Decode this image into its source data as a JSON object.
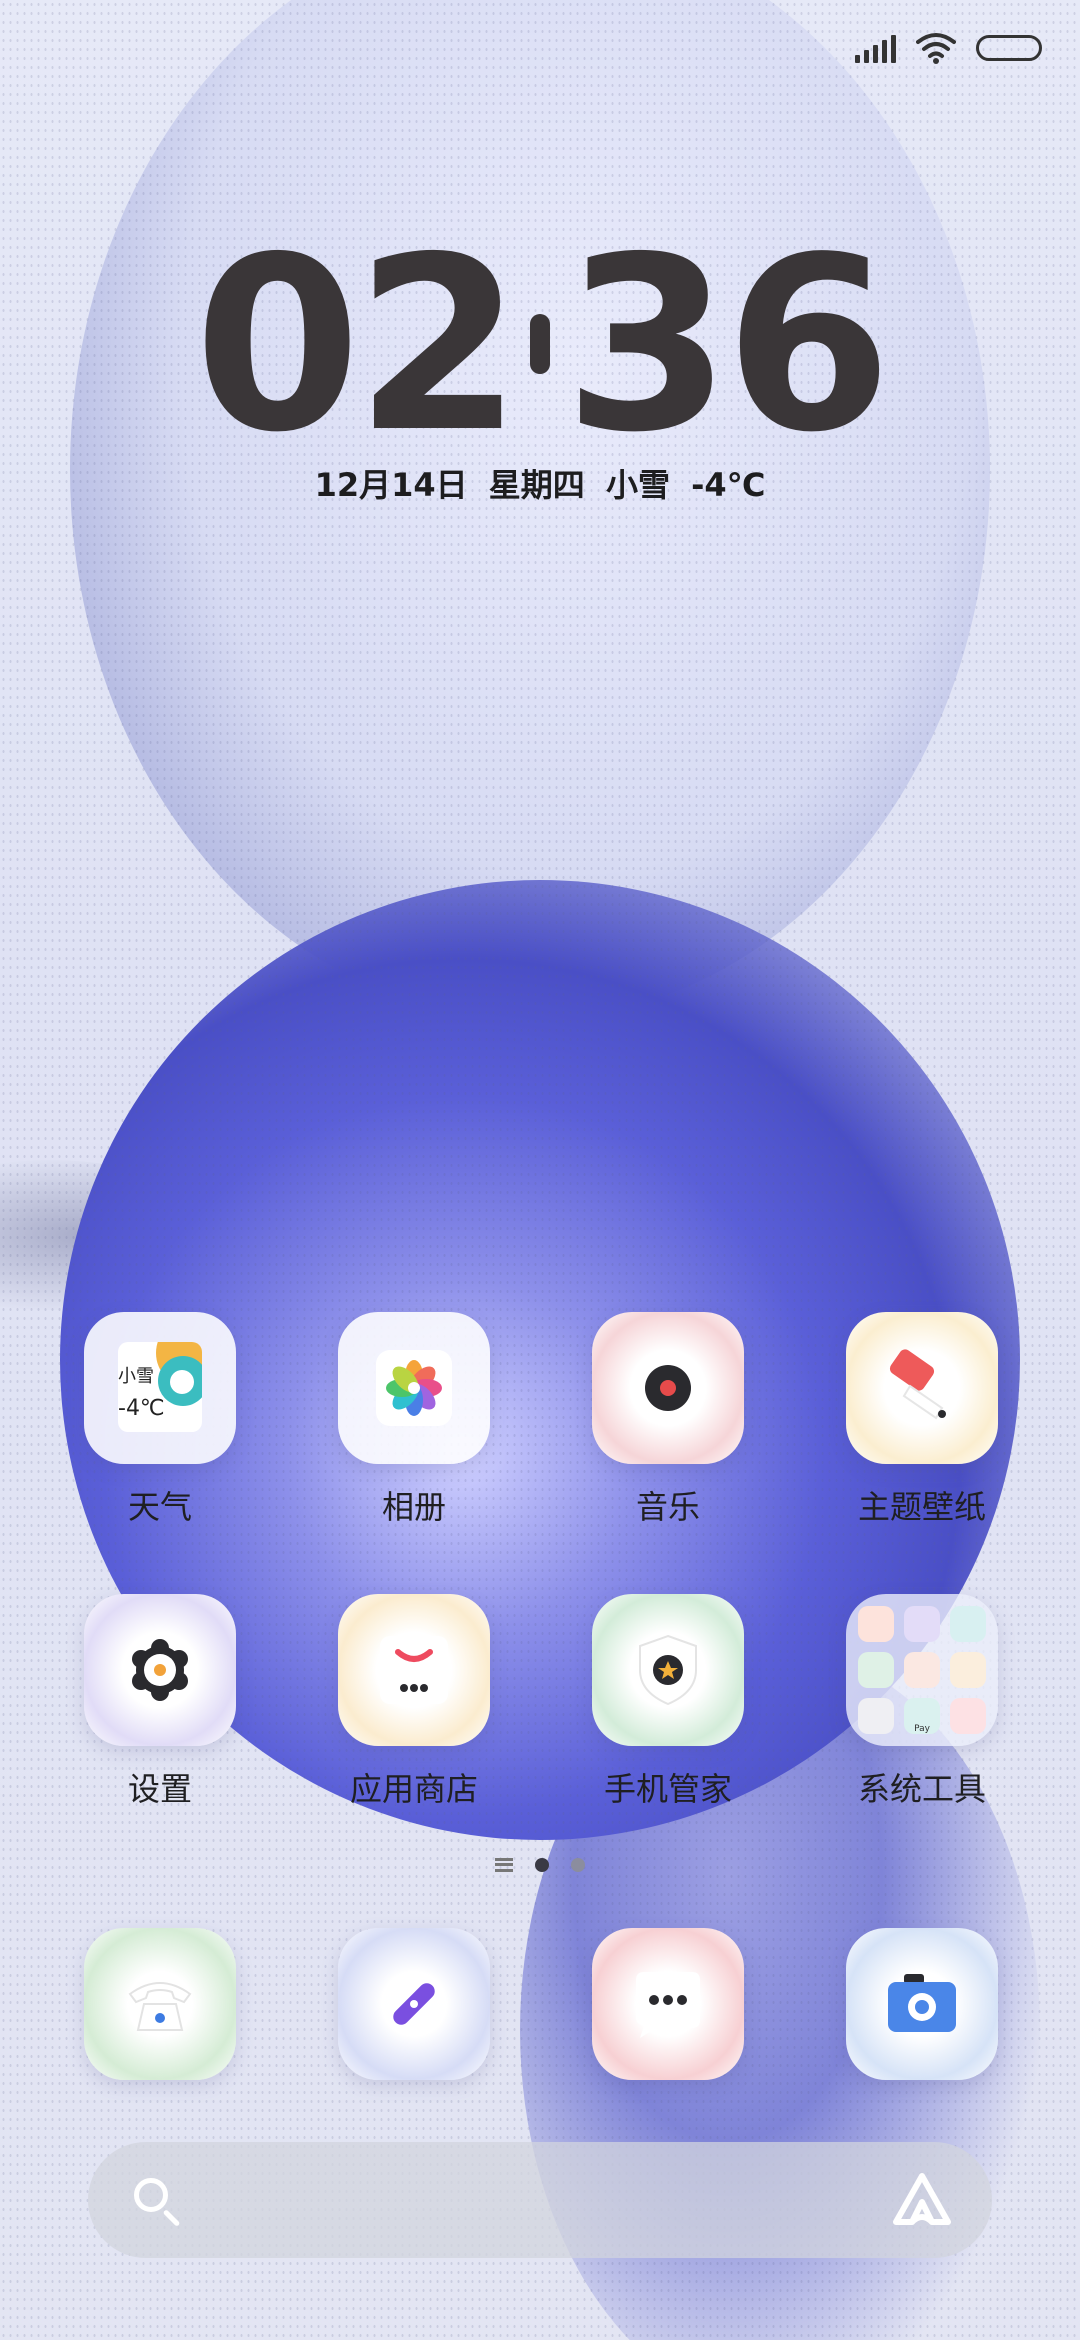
{
  "status_bar": {
    "icons": [
      "signal-icon",
      "wifi-icon",
      "battery-icon"
    ]
  },
  "lock_clock": {
    "hour": "02",
    "minute": "36",
    "date_line": "12月14日  星期四  小雪  -4℃"
  },
  "apps_row1": [
    {
      "label": "天气",
      "icon": "weather-widget-icon",
      "widget_text": "小雪",
      "widget_temp": "-4℃"
    },
    {
      "label": "相册",
      "icon": "gallery-icon"
    },
    {
      "label": "音乐",
      "icon": "music-icon"
    },
    {
      "label": "主题壁纸",
      "icon": "themes-icon"
    }
  ],
  "apps_row2": [
    {
      "label": "设置",
      "icon": "settings-icon"
    },
    {
      "label": "应用商店",
      "icon": "app-store-icon"
    },
    {
      "label": "手机管家",
      "icon": "security-icon"
    },
    {
      "label": "系统工具",
      "icon": "folder-icon",
      "folder_badge": "Pay"
    }
  ],
  "dock": [
    {
      "icon": "phone-icon"
    },
    {
      "icon": "browser-icon"
    },
    {
      "icon": "messages-icon"
    },
    {
      "icon": "camera-icon"
    }
  ],
  "page_indicator": {
    "pages": 2,
    "current": 1
  },
  "search_bar": {
    "icon": "search-icon",
    "assistant_icon": "assistant-icon"
  },
  "colors": {
    "clock": "#3a3638",
    "accent_blue": "#4a4fc6"
  }
}
